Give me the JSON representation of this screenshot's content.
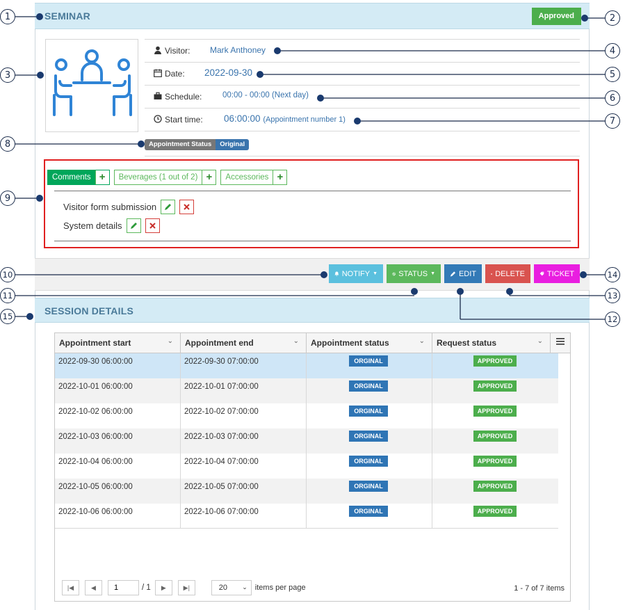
{
  "seminar": {
    "title": "SEMINAR",
    "status_badge": "Approved",
    "visitor_label": "Visitor:",
    "visitor_value": "Mark Anthoney",
    "date_label": "Date:",
    "date_value": "2022-09-30",
    "schedule_label": "Schedule:",
    "schedule_value": "00:00 - 00:00 (Next day)",
    "start_label": "Start time:",
    "start_value": "06:00:00",
    "start_sub": "(Appointment number 1)",
    "appointment_status_label": "Appointment Status",
    "appointment_status_value": "Original"
  },
  "tabs": [
    {
      "label": "Comments",
      "active": true
    },
    {
      "label": "Beverages (1 out of 2)",
      "active": false
    },
    {
      "label": "Accessories",
      "active": false
    }
  ],
  "comments": [
    {
      "label": "Visitor form submission"
    },
    {
      "label": "System details"
    }
  ],
  "actions": {
    "notify": "NOTIFY",
    "status": "STATUS",
    "edit": "EDIT",
    "delete": "DELETE",
    "ticket": "TICKET"
  },
  "session": {
    "title": "SESSION DETAILS",
    "columns": [
      "Appointment start",
      "Appointment end",
      "Appointment status",
      "Request status"
    ],
    "rows": [
      {
        "start": "2022-09-30 06:00:00",
        "end": "2022-09-30 07:00:00",
        "appt": "ORGINAL",
        "req": "APPROVED"
      },
      {
        "start": "2022-10-01 06:00:00",
        "end": "2022-10-01 07:00:00",
        "appt": "ORGINAL",
        "req": "APPROVED"
      },
      {
        "start": "2022-10-02 06:00:00",
        "end": "2022-10-02 07:00:00",
        "appt": "ORGINAL",
        "req": "APPROVED"
      },
      {
        "start": "2022-10-03 06:00:00",
        "end": "2022-10-03 07:00:00",
        "appt": "ORGINAL",
        "req": "APPROVED"
      },
      {
        "start": "2022-10-04 06:00:00",
        "end": "2022-10-04 07:00:00",
        "appt": "ORGINAL",
        "req": "APPROVED"
      },
      {
        "start": "2022-10-05 06:00:00",
        "end": "2022-10-05 07:00:00",
        "appt": "ORGINAL",
        "req": "APPROVED"
      },
      {
        "start": "2022-10-06 06:00:00",
        "end": "2022-10-06 07:00:00",
        "appt": "ORGINAL",
        "req": "APPROVED"
      }
    ],
    "pager": {
      "page": "1",
      "total_pages": "/ 1",
      "page_size": "20",
      "page_size_label": "items per page",
      "summary": "1 - 7 of 7 items"
    }
  },
  "callouts": [
    "1",
    "2",
    "3",
    "4",
    "5",
    "6",
    "7",
    "8",
    "9",
    "10",
    "11",
    "12",
    "13",
    "14",
    "15"
  ],
  "colors": {
    "header_bg": "#d4ebf5",
    "approved": "#4cae4c",
    "original": "#2f75b5",
    "notify": "#5bc0de",
    "status": "#5cb85c",
    "edit": "#337ab7",
    "delete": "#d9534f",
    "ticket": "#e91ee0",
    "highlight_box": "#e02020"
  }
}
